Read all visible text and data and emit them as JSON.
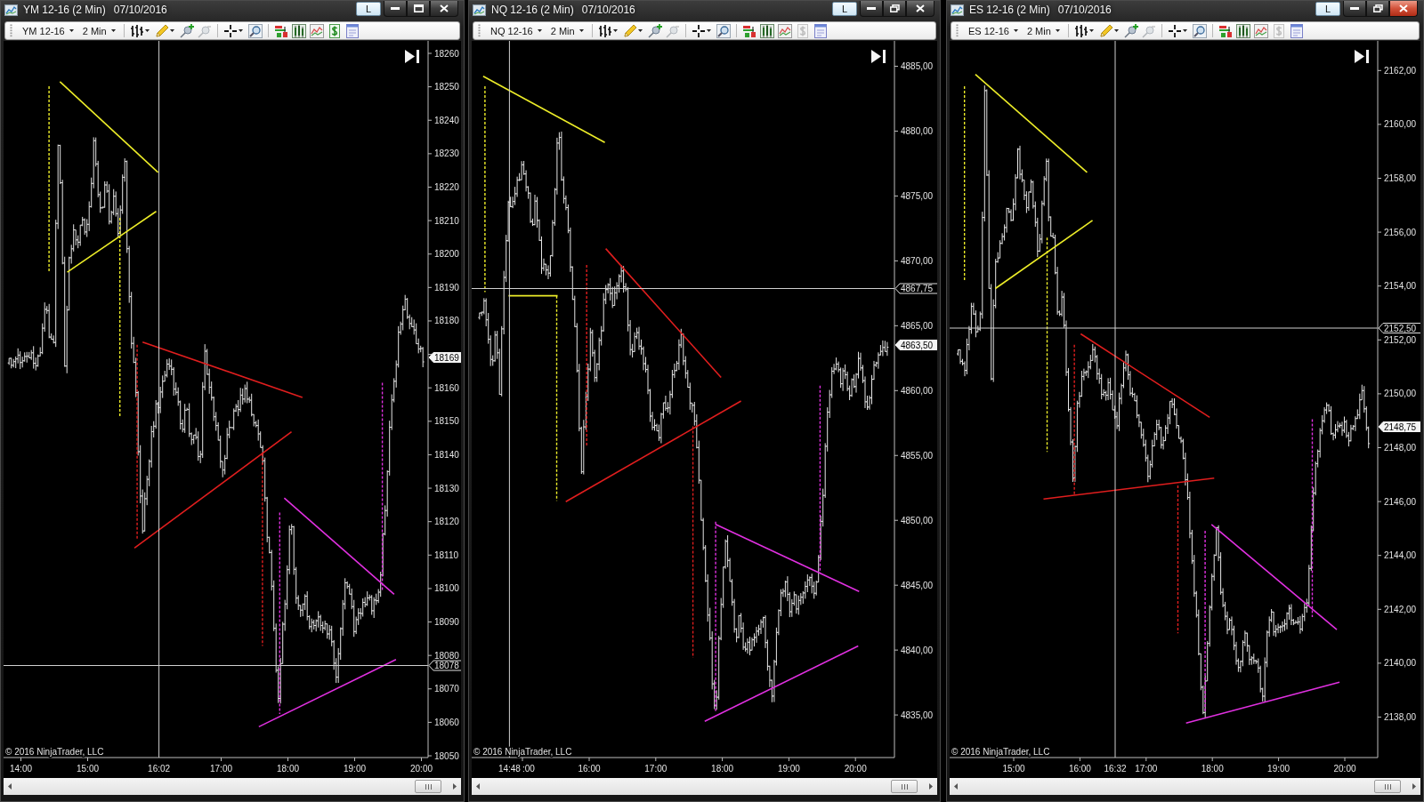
{
  "windows": [
    {
      "title": "YM 12-16 (2 Min)",
      "date": "07/10/2016",
      "link_button": "L",
      "maximized": false,
      "active": false,
      "toolbar": {
        "instrument": "YM 12-16",
        "interval": "2 Min",
        "cash_button_disabled": false
      },
      "chart": {
        "price_ticks": [
          "18260",
          "18250",
          "18240",
          "18230",
          "18220",
          "18210",
          "18200",
          "18190",
          "18180",
          "18160",
          "18150",
          "18140",
          "18130",
          "18120",
          "18110",
          "18100",
          "18090",
          "18080",
          "18070",
          "18060",
          "18050"
        ],
        "last_price": "18169",
        "crosshair_price": "18078",
        "time_ticks": [
          "14:00",
          "15:00",
          "17:00",
          "18:00",
          "19:00",
          "20:00"
        ],
        "crosshair_time": "16:02",
        "copyright": "© 2016 NinjaTrader, LLC"
      }
    },
    {
      "title": "NQ 12-16 (2 Min)",
      "date": "07/10/2016",
      "link_button": "L",
      "maximized": true,
      "active": false,
      "toolbar": {
        "instrument": "NQ 12-16",
        "interval": "2 Min",
        "cash_button_disabled": true
      },
      "chart": {
        "price_ticks": [
          "4885,00",
          "4880,00",
          "4875,00",
          "4870,00",
          "4865,00",
          "4860,00",
          "4855,00",
          "4850,00",
          "4845,00",
          "4840,00",
          "4835,00"
        ],
        "last_price": "4863,50",
        "crosshair_price": "4867,75",
        "time_ticks": [
          ":00",
          "16:00",
          "17:00",
          "18:00",
          "19:00",
          "20:00"
        ],
        "crosshair_time": "14:48",
        "copyright": "© 2016 NinjaTrader, LLC"
      }
    },
    {
      "title": "ES 12-16 (2 Min)",
      "date": "07/10/2016",
      "link_button": "L",
      "maximized": true,
      "active": true,
      "toolbar": {
        "instrument": "ES 12-16",
        "interval": "2 Min",
        "cash_button_disabled": true
      },
      "chart": {
        "price_ticks": [
          "2162,00",
          "2160,00",
          "2158,00",
          "2156,00",
          "2154,00",
          "2152,00",
          "2150,00",
          "2148,00",
          "2146,00",
          "2144,00",
          "2142,00",
          "2140,00",
          "2138,00"
        ],
        "last_price": "2148,75",
        "crosshair_price": "2152,50",
        "time_ticks": [
          "15:00",
          "16:00",
          "17:00",
          "18:00",
          "19:00",
          "20:00"
        ],
        "crosshair_time": "16:32",
        "copyright": "© 2016 NinjaTrader, LLC"
      }
    }
  ]
}
